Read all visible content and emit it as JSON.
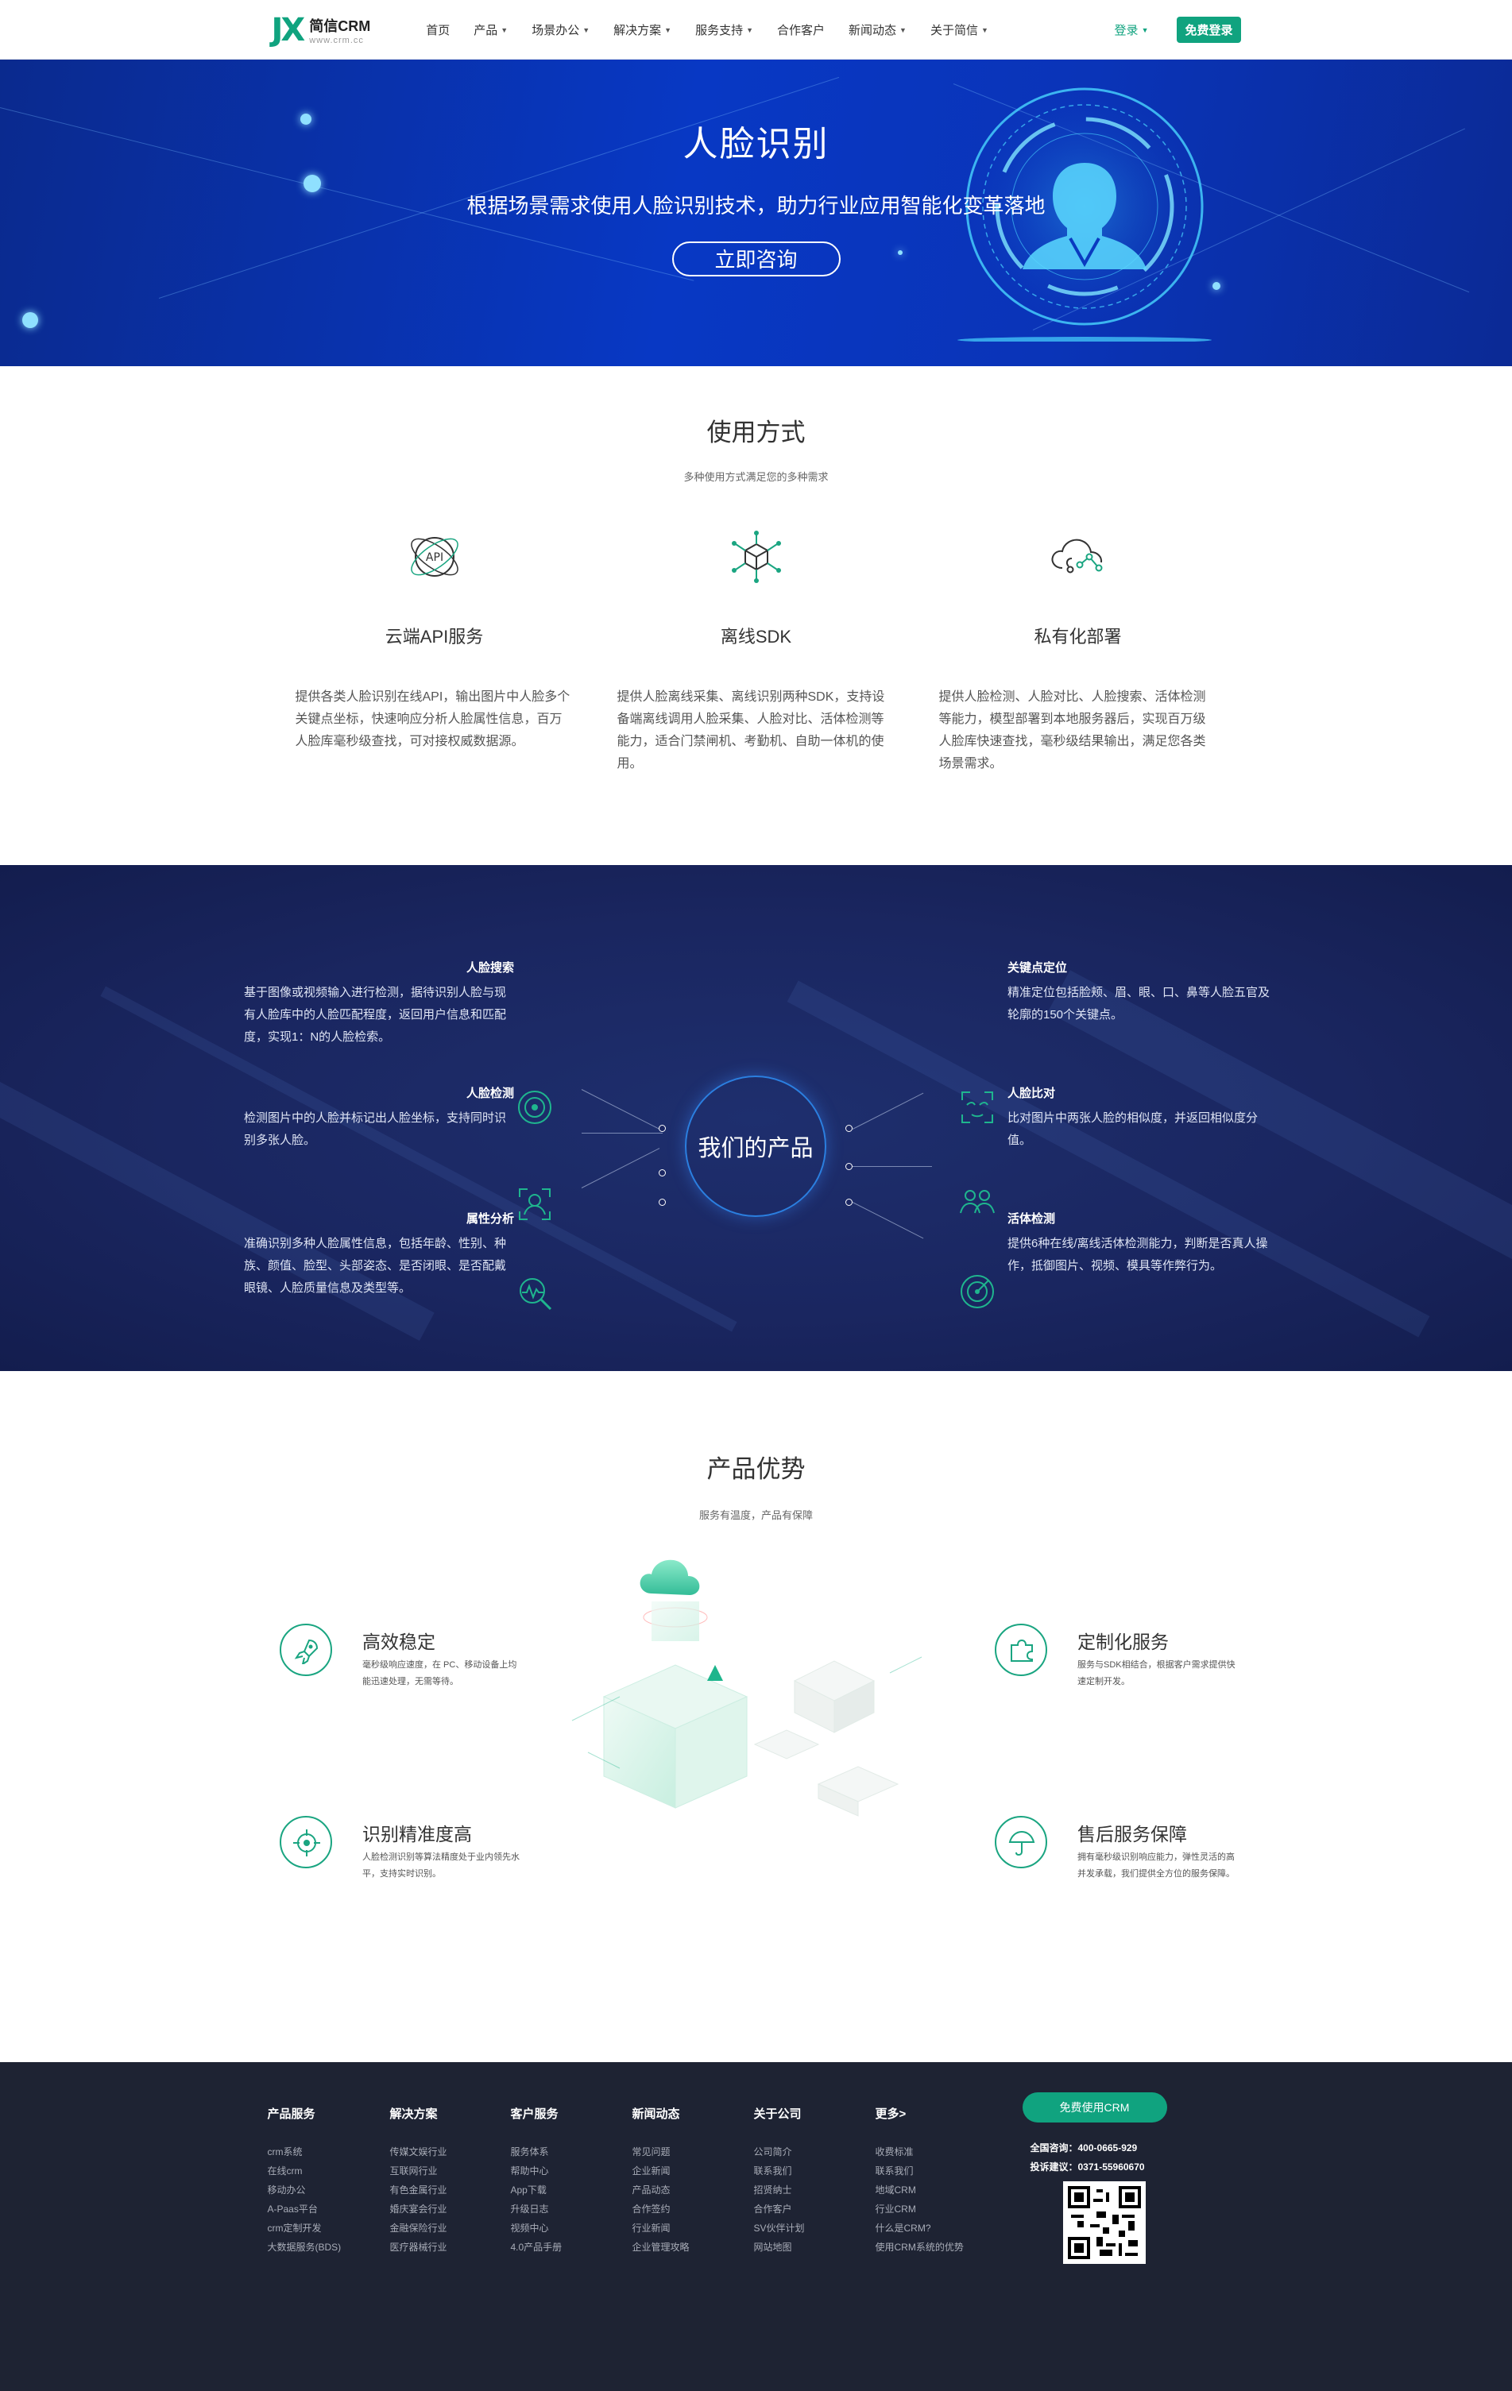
{
  "header": {
    "logo_mark": "JX",
    "logo_name": "简信CRM",
    "logo_url": "www.crm.cc",
    "nav": [
      {
        "label": "首页",
        "has_caret": false
      },
      {
        "label": "产品",
        "has_caret": true
      },
      {
        "label": "场景办公",
        "has_caret": true
      },
      {
        "label": "解决方案",
        "has_caret": true
      },
      {
        "label": "服务支持",
        "has_caret": true
      },
      {
        "label": "合作客户",
        "has_caret": false
      },
      {
        "label": "新闻动态",
        "has_caret": true
      },
      {
        "label": "关于简信",
        "has_caret": true
      }
    ],
    "login_label": "登录",
    "free_login_label": "免费登录",
    "accent_color": "#10a37f"
  },
  "hero": {
    "title": "人脸识别",
    "subtitle": "根据场景需求使用人脸识别技术，助力行业应用智能化变革落地",
    "button": "立即咨询"
  },
  "usage": {
    "title": "使用方式",
    "subtitle": "多种使用方式满足您的多种需求",
    "items": [
      {
        "icon": "api-icon",
        "name": "云端API服务",
        "desc": "提供各类人脸识别在线API，输出图片中人脸多个关键点坐标，快速响应分析人脸属性信息，百万人脸库毫秒级查找，可对接权威数据源。"
      },
      {
        "icon": "cube-network-icon",
        "name": "离线SDK",
        "desc": "提供人脸离线采集、离线识别两种SDK，支持设备端离线调用人脸采集、人脸对比、活体检测等能力，适合门禁闸机、考勤机、自助一体机的使用。"
      },
      {
        "icon": "cloud-network-icon",
        "name": "私有化部署",
        "desc": "提供人脸检测、人脸对比、人脸搜索、活体检测等能力，模型部署到本地服务器后，实现百万级人脸库快速查找，毫秒级结果输出，满足您各类场景需求。"
      }
    ]
  },
  "products": {
    "center_label": "我们的产品",
    "left": [
      {
        "icon": "face-search-icon",
        "title": "人脸搜索",
        "desc": "基于图像或视频输入进行检测，据待识别人脸与现有人脸库中的人脸匹配程度，返回用户信息和匹配度，实现1：N的人脸检索。"
      },
      {
        "icon": "face-detect-icon",
        "title": "人脸检测",
        "desc": "检测图片中的人脸并标记出人脸坐标，支持同时识别多张人脸。"
      },
      {
        "icon": "attribute-analysis-icon",
        "title": "属性分析",
        "desc": "准确识别多种人脸属性信息，包括年龄、性别、种族、颜值、脸型、头部姿态、是否闭眼、是否配戴眼镜、人脸质量信息及类型等。"
      }
    ],
    "right": [
      {
        "icon": "keypoint-icon",
        "title": "关键点定位",
        "desc": "精准定位包括脸颊、眉、眼、口、鼻等人脸五官及轮廓的150个关键点。"
      },
      {
        "icon": "face-compare-icon",
        "title": "人脸比对",
        "desc": "比对图片中两张人脸的相似度，并返回相似度分值。"
      },
      {
        "icon": "liveness-icon",
        "title": "活体检测",
        "desc": "提供6种在线/离线活体检测能力，判断是否真人操作，抵御图片、视频、模具等作弊行为。"
      }
    ]
  },
  "advantage": {
    "title": "产品优势",
    "subtitle": "服务有温度，产品有保障",
    "items": [
      {
        "icon": "rocket-icon",
        "name": "高效稳定",
        "desc": "毫秒级响应速度，在 PC、移动设备上均能迅速处理，无需等待。"
      },
      {
        "icon": "target-icon",
        "name": "识别精准度高",
        "desc": "人脸检测识别等算法精度处于业内领先水平，支持实时识别。"
      },
      {
        "icon": "puzzle-icon",
        "name": "定制化服务",
        "desc": "服务与SDK相结合，根据客户需求提供快速定制开发。"
      },
      {
        "icon": "umbrella-icon",
        "name": "售后服务保障",
        "desc": "拥有毫秒级识别响应能力，弹性灵活的高并发承载，我们提供全方位的服务保障。"
      }
    ]
  },
  "footer": {
    "columns": [
      {
        "title": "产品服务",
        "links": [
          "crm系统",
          "在线crm",
          "移动办公",
          "A-Paas平台",
          "crm定制开发",
          "大数据服务(BDS)"
        ]
      },
      {
        "title": "解决方案",
        "links": [
          "传媒文娱行业",
          "互联网行业",
          "有色金属行业",
          "婚庆宴会行业",
          "金融保险行业",
          "医疗器械行业"
        ]
      },
      {
        "title": "客户服务",
        "links": [
          "服务体系",
          "帮助中心",
          "App下载",
          "升级日志",
          "视频中心",
          "4.0产品手册"
        ]
      },
      {
        "title": "新闻动态",
        "links": [
          "常见问题",
          "企业新闻",
          "产品动态",
          "合作签约",
          "行业新闻",
          "企业管理攻略"
        ]
      },
      {
        "title": "关于公司",
        "links": [
          "公司简介",
          "联系我们",
          "招贤纳士",
          "合作客户",
          "SV伙伴计划",
          "网站地图"
        ]
      },
      {
        "title": "更多>",
        "links": [
          "收费标准",
          "联系我们",
          "地域CRM",
          "行业CRM",
          "什么是CRM?",
          "使用CRM系统的优势"
        ]
      }
    ],
    "free_button": "免费使用CRM",
    "phone": "全国咨询：400-0665-929",
    "complaint": "投诉建议：0371-55960670",
    "qr": "qr-code-icon"
  }
}
